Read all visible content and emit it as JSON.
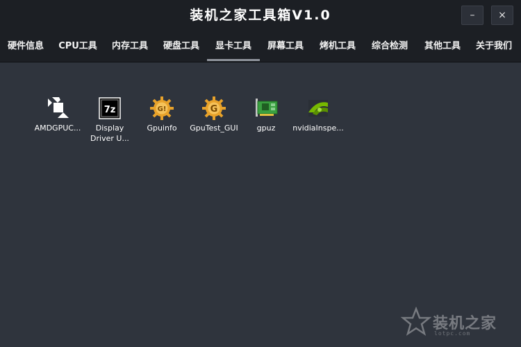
{
  "window": {
    "title": "装机之家工具箱V1.0",
    "minimize_glyph": "–",
    "close_glyph": "×"
  },
  "tabs": [
    {
      "label": "硬件信息",
      "active": false
    },
    {
      "label": "CPU工具",
      "active": false
    },
    {
      "label": "内存工具",
      "active": false
    },
    {
      "label": "硬盘工具",
      "active": false
    },
    {
      "label": "显卡工具",
      "active": true
    },
    {
      "label": "屏幕工具",
      "active": false
    },
    {
      "label": "烤机工具",
      "active": false
    },
    {
      "label": "综合检测",
      "active": false
    },
    {
      "label": "其他工具",
      "active": false
    },
    {
      "label": "关于我们",
      "active": false
    }
  ],
  "desktop_items": [
    {
      "label": "AMDGPUC...",
      "icon": "amd-arrow-icon"
    },
    {
      "label": "Display Driver U...",
      "icon": "7z-archive-icon"
    },
    {
      "label": "Gpuinfo",
      "icon": "gpuinfo-gear-icon"
    },
    {
      "label": "GpuTest_GUI",
      "icon": "gputest-gear-icon"
    },
    {
      "label": "gpuz",
      "icon": "graphics-card-icon"
    },
    {
      "label": "nvidiaInspe...",
      "icon": "nvidia-eye-icon"
    }
  ],
  "watermark": {
    "text": "装机之家",
    "sub": "lotpc.com"
  },
  "colors": {
    "background": "#2f343d",
    "titlebar": "#1c1f24",
    "text": "#ffffff",
    "tab_indicator": "#8f949c",
    "gear_orange": "#e8a22a",
    "gpu_green": "#5cb85c",
    "nvidia_green": "#76b900"
  }
}
